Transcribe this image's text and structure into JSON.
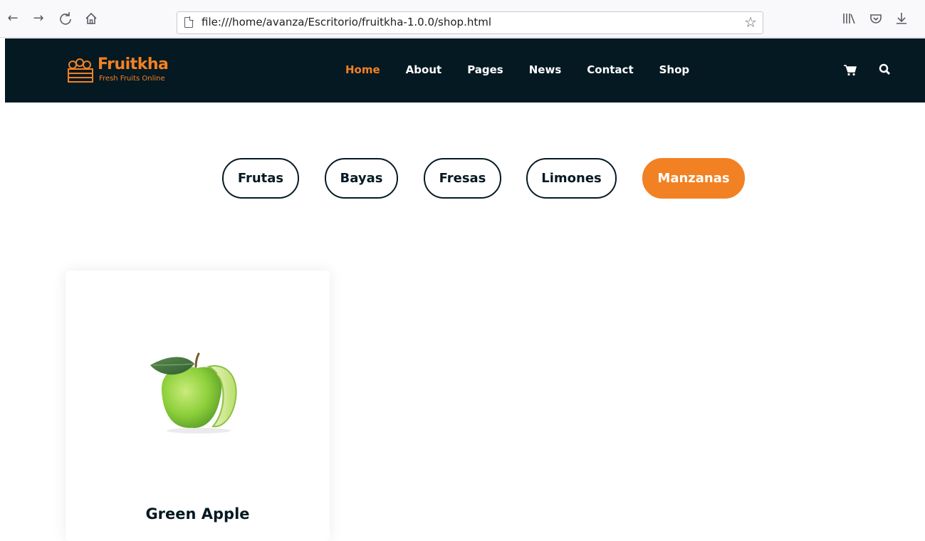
{
  "browser": {
    "url": "file:///home/avanza/Escritorio/fruitkha-1.0.0/shop.html",
    "icons": [
      "back-icon",
      "forward-icon",
      "reload-icon",
      "home-icon",
      "bookmark-star-icon",
      "library-icon",
      "pocket-icon",
      "download-icon"
    ]
  },
  "header": {
    "brand": "Fruitkha",
    "tagline": "Fresh Fruits Online",
    "nav": [
      "Home",
      "About",
      "Pages",
      "News",
      "Contact",
      "Shop"
    ],
    "active_nav": "Home",
    "icons": [
      "cart-icon",
      "search-icon"
    ]
  },
  "filters": {
    "items": [
      "Frutas",
      "Bayas",
      "Fresas",
      "Limones",
      "Manzanas"
    ],
    "active": "Manzanas"
  },
  "products": [
    {
      "name": "Green Apple",
      "image": "green-apple-image"
    }
  ],
  "colors": {
    "accent": "#F28123",
    "header_bg": "#051922",
    "text_dark": "#051922"
  }
}
